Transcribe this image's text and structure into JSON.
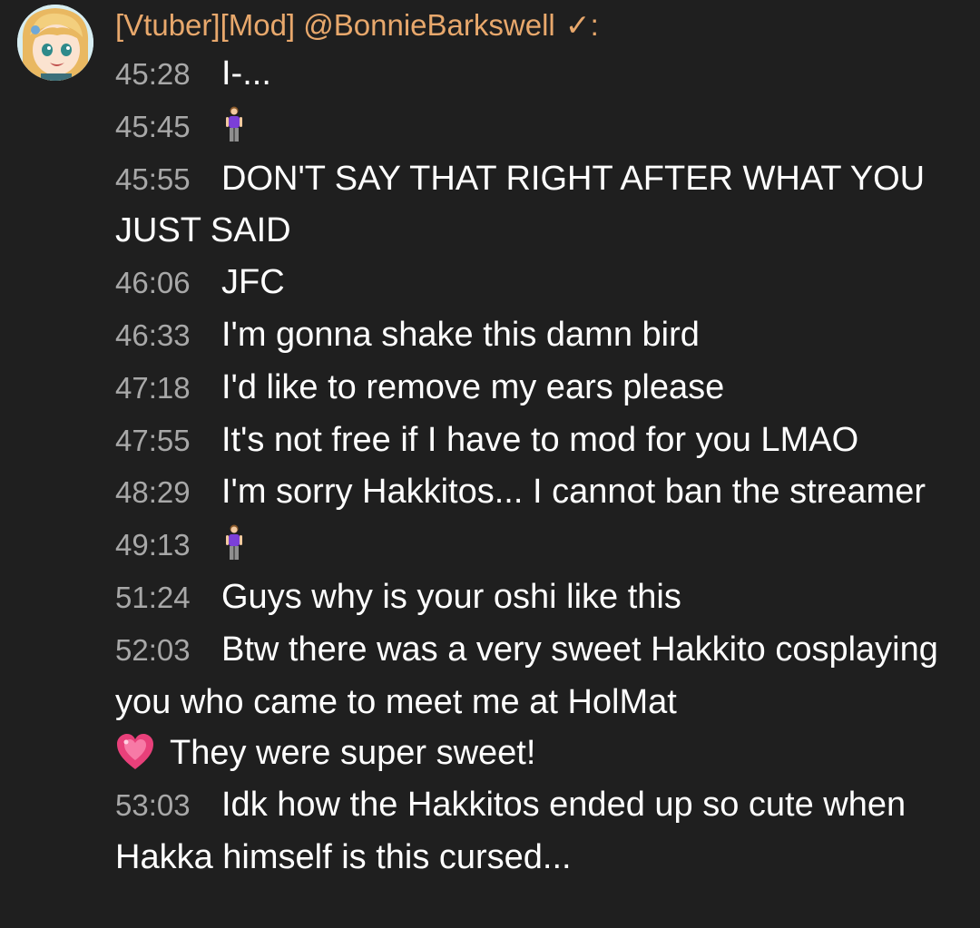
{
  "author": {
    "badges": "[Vtuber][Mod]",
    "handle": "@BonnieBarkswell",
    "verified_mark": "✓",
    "colon": ":"
  },
  "colors": {
    "background": "#1f1f1f",
    "author_name": "#e8a86c",
    "timestamp": "#a8a8a8",
    "message_text": "#ffffff"
  },
  "messages": [
    {
      "time": "45:28",
      "text": "I-..."
    },
    {
      "time": "45:45",
      "emoji": "person-standing-icon"
    },
    {
      "time": "45:55",
      "text": "DON'T SAY THAT RIGHT AFTER WHAT YOU JUST SAID"
    },
    {
      "time": "46:06",
      "text": "JFC"
    },
    {
      "time": "46:33",
      "text": "I'm gonna shake this damn bird"
    },
    {
      "time": "47:18",
      "text": "I'd like to remove my ears please"
    },
    {
      "time": "47:55",
      "text": "It's not free if I have to mod for you LMAO"
    },
    {
      "time": "48:29",
      "text": "I'm sorry Hakkitos... I cannot ban the streamer"
    },
    {
      "time": "49:13",
      "emoji": "person-standing-icon"
    },
    {
      "time": "51:24",
      "text": "Guys why is your oshi like this"
    },
    {
      "time": "52:03",
      "text": "Btw there was a very sweet Hakkito cosplaying you who came to meet me at HolMat",
      "tail_emoji": "sparkling-heart-icon",
      "tail_text": "They were super sweet!"
    },
    {
      "time": "53:03",
      "text": "Idk how the Hakkitos ended up so cute when Hakka himself is this cursed..."
    }
  ]
}
